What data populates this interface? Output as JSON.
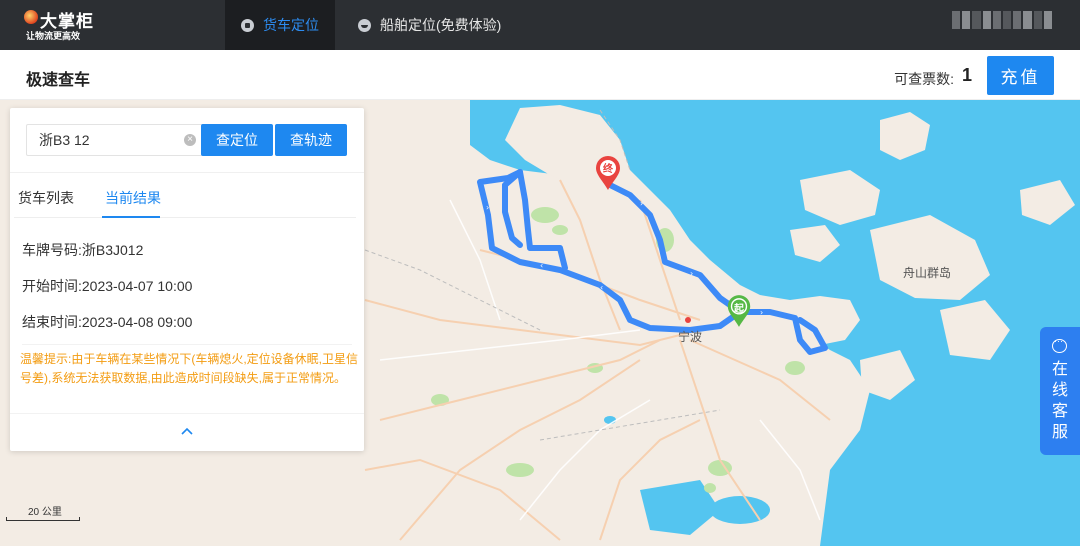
{
  "brand": {
    "title": "大掌柜",
    "subtitle": "让物流更高效"
  },
  "nav": {
    "tabs": [
      {
        "label": "货车定位",
        "active": true,
        "icon": "truck-icon"
      },
      {
        "label": "船舶定位(免费体验)",
        "active": false,
        "icon": "ship-icon"
      }
    ]
  },
  "header": {
    "title": "极速查车",
    "query_label": "可查票数:",
    "query_count": "1",
    "recharge_label": "充值"
  },
  "search": {
    "value": "浙B3 12",
    "locate_label": "查定位",
    "track_label": "查轨迹"
  },
  "tabs": {
    "list_label": "货车列表",
    "result_label": "当前结果"
  },
  "result": {
    "plate_label": "车牌号码:",
    "plate_value": "浙B3J012",
    "start_label": "开始时间:",
    "start_value": "2023-04-07 10:00",
    "end_label": "结束时间:",
    "end_value": "2023-04-08 09:00"
  },
  "notice": "温馨提示:由于车辆在某些情况下(车辆熄火,定位设备休眠,卫星信号差),系统无法获取数据,由此造成时间段缺失,属于正常情况。",
  "map": {
    "labels": {
      "city": "宁波",
      "islands": "舟山群岛"
    },
    "start_marker": "起",
    "end_marker": "终",
    "scale": "20 公里",
    "colors": {
      "water": "#54c5f0",
      "land": "#f3ece4",
      "route": "#3d8af7",
      "start": "#56b845",
      "end": "#e9433f"
    }
  },
  "service": {
    "label": "在线客服"
  }
}
